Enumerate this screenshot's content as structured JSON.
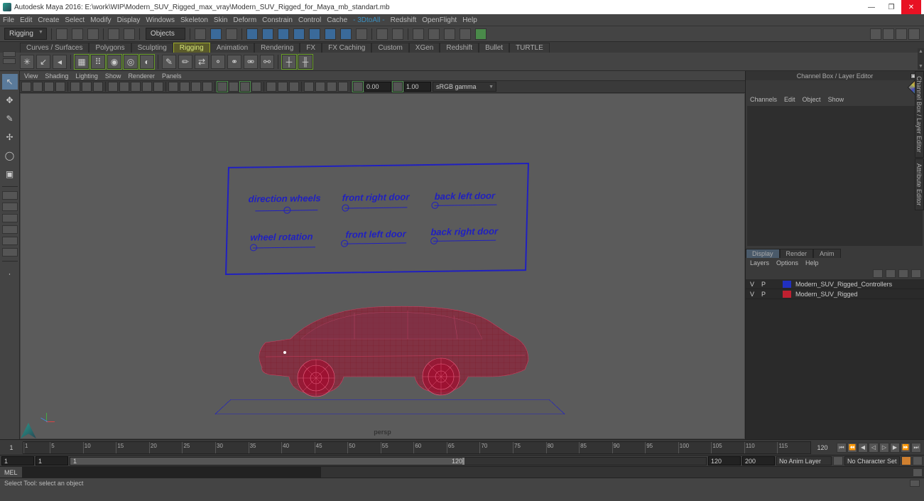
{
  "title": "Autodesk Maya 2016: E:\\work\\WIP\\Modern_SUV_Rigged_max_vray\\Modern_SUV_Rigged_for_Maya_mb_standart.mb",
  "window": {
    "minimize": "—",
    "maximize": "❐",
    "close": "✕"
  },
  "menu": [
    "File",
    "Edit",
    "Create",
    "Select",
    "Modify",
    "Display",
    "Windows",
    "Skeleton",
    "Skin",
    "Deform",
    "Constrain",
    "Control",
    "Cache",
    "- 3DtoAll -",
    "Redshift",
    "OpenFlight",
    "Help"
  ],
  "modeSelector": "Rigging",
  "objectsLabel": "Objects",
  "shelfTabs": [
    "Curves / Surfaces",
    "Polygons",
    "Sculpting",
    "Rigging",
    "Animation",
    "Rendering",
    "FX",
    "FX Caching",
    "Custom",
    "XGen",
    "Redshift",
    "Bullet",
    "TURTLE"
  ],
  "shelfActive": "Rigging",
  "viewportMenu": [
    "View",
    "Shading",
    "Lighting",
    "Show",
    "Renderer",
    "Panels"
  ],
  "vpNum1": "0.00",
  "vpNum2": "1.00",
  "gamma": "sRGB gamma",
  "camera": "persp",
  "controls": {
    "c1": "direction wheels",
    "c2": "front right door",
    "c3": "back left door",
    "c4": "wheel rotation",
    "c5": "front left door",
    "c6": "back right door"
  },
  "rightPanel": {
    "title": "Channel Box / Layer Editor",
    "menu1": [
      "Channels",
      "Edit",
      "Object",
      "Show"
    ],
    "tabs": [
      "Display",
      "Render",
      "Anim"
    ],
    "tabActive": "Display",
    "menu2": [
      "Layers",
      "Options",
      "Help"
    ],
    "layers": [
      {
        "v": "V",
        "p": "P",
        "color": "#2030c0",
        "name": "Modern_SUV_Rigged_Controllers"
      },
      {
        "v": "V",
        "p": "P",
        "color": "#c02030",
        "name": "Modern_SUV_Rigged"
      }
    ]
  },
  "sideTabs": [
    "Channel Box / Layer Editor",
    "Attribute Editor"
  ],
  "timeline": {
    "start": "1",
    "end": "120",
    "ticks": [
      1,
      5,
      10,
      15,
      20,
      25,
      30,
      35,
      40,
      45,
      50,
      55,
      60,
      65,
      70,
      75,
      80,
      85,
      90,
      95,
      100,
      105,
      110,
      115,
      120
    ]
  },
  "range": {
    "in1": "1",
    "in2": "1",
    "in3": "1",
    "in4": "120",
    "out1": "120",
    "out2": "200",
    "animLayer": "No Anim Layer",
    "charSet": "No Character Set"
  },
  "mel": "MEL",
  "status": "Select Tool: select an object"
}
